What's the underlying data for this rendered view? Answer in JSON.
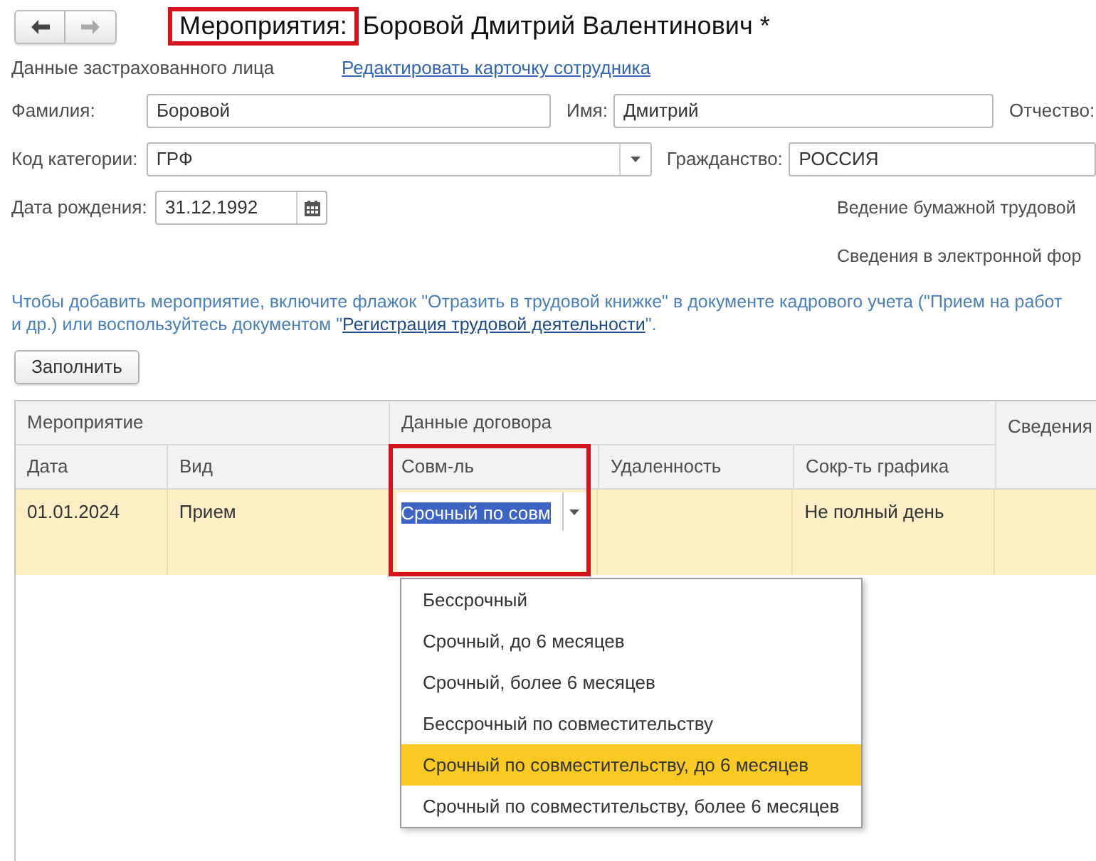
{
  "toolbar": {
    "nav_buttons": [
      {
        "kind": "back",
        "disabled": false
      },
      {
        "kind": "forward",
        "disabled": true
      }
    ]
  },
  "title": {
    "label": "Мероприятия:",
    "label_highlighted": true,
    "name": "Боровой Дмитрий Валентинович *"
  },
  "insured_person": {
    "heading": "Данные застрахованного лица",
    "edit_link": "Редактировать карточку сотрудника"
  },
  "surname": {
    "label": "Фамилия:",
    "value": "Боровой"
  },
  "first_name": {
    "label": "Имя:",
    "value": "Дмитрий"
  },
  "patronymic": {
    "label": "Отчество:"
  },
  "category_code": {
    "label": "Код категории:",
    "value": "ГРФ"
  },
  "citizenship": {
    "label": "Гражданство:",
    "value": "РОССИЯ"
  },
  "birth_date": {
    "label": "Дата рождения:",
    "value": "31.12.1992"
  },
  "paper_record_label": "Ведение бумажной трудовой",
  "electronic_info_label": "Сведения в электронной фор",
  "note": {
    "line_1": "Чтобы добавить мероприятие, включите флажок \"Отразить в трудовой книжке\" в документе кадрового учета (\"Прием на работ",
    "line_2": "и др.) или воспользуйтесь документом \"",
    "link": "Регистрация трудовой деятельности",
    "line_2_end": "\"."
  },
  "fill_button": "Заполнить",
  "table": {
    "column_groups": [
      {
        "label": "Мероприятие",
        "columns": [
          {
            "label": "Дата",
            "highlighted": false
          },
          {
            "label": "Вид",
            "highlighted": false
          }
        ]
      },
      {
        "label": "Данные договора",
        "columns": [
          {
            "label": "Совм-ль",
            "highlighted": true
          },
          {
            "label": "Удаленность",
            "highlighted": false
          },
          {
            "label": "Сокр-ть графика",
            "highlighted": false
          }
        ]
      },
      {
        "label": "Сведения"
      }
    ],
    "rows": [
      {
        "selected": true,
        "date": "01.01.2024",
        "type": "Прием",
        "part_time": {
          "value": "Срочный по совм",
          "value_selected": true,
          "list_open": true,
          "options": [
            {
              "label": "Бессрочный",
              "selected": false
            },
            {
              "label": "Срочный, до 6 месяцев",
              "selected": false
            },
            {
              "label": "Срочный, более 6 месяцев",
              "selected": false
            },
            {
              "label": "Бессрочный по совместительству",
              "selected": false
            },
            {
              "label": "Срочный по совместительству, до 6 месяцев",
              "selected": true
            },
            {
              "label": "Срочный по совместительству, более 6 месяцев",
              "selected": false
            }
          ]
        },
        "schedule_reduction": "Не полный день"
      }
    ]
  }
}
